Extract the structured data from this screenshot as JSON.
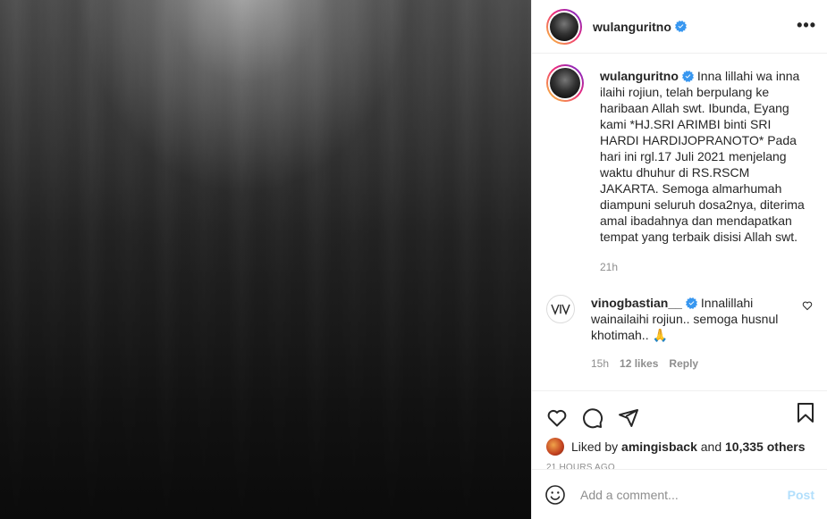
{
  "post": {
    "username": "wulanguritno",
    "more_label": "•••"
  },
  "caption": {
    "username": "wulanguritno",
    "text": "Inna lillahi wa inna ilaihi rojiun, telah berpulang ke haribaan Allah swt. Ibunda, Eyang kami *HJ.SRI ARIMBI binti SRI HARDI HARDIJOPRANOTO* Pada hari ini rgl.17 Juli 2021 menjelang waktu dhuhur di RS.RSCM JAKARTA. Semoga almarhumah diampuni seluruh dosa2nya, diterima amal ibadahnya dan mendapatkan tempat yang terbaik disisi Allah swt.",
    "time": "21h"
  },
  "comments": [
    {
      "username": "vinogbastian__",
      "avatar_text": "VIV",
      "text": "Innalillahi wainailaihi rojiun.. semoga husnul khotimah.. 🙏",
      "time": "15h",
      "likes": "12 likes",
      "reply_label": "Reply"
    }
  ],
  "likes": {
    "prefix": "Liked by",
    "user": "amingisback",
    "conj": "and",
    "others": "10,335 others"
  },
  "timestamp": "21 HOURS AGO",
  "comment_box": {
    "placeholder": "Add a comment...",
    "post_label": "Post"
  },
  "colors": {
    "verified": "#3897f0",
    "post_disabled": "#b2dffc",
    "muted": "#8e8e8e"
  }
}
